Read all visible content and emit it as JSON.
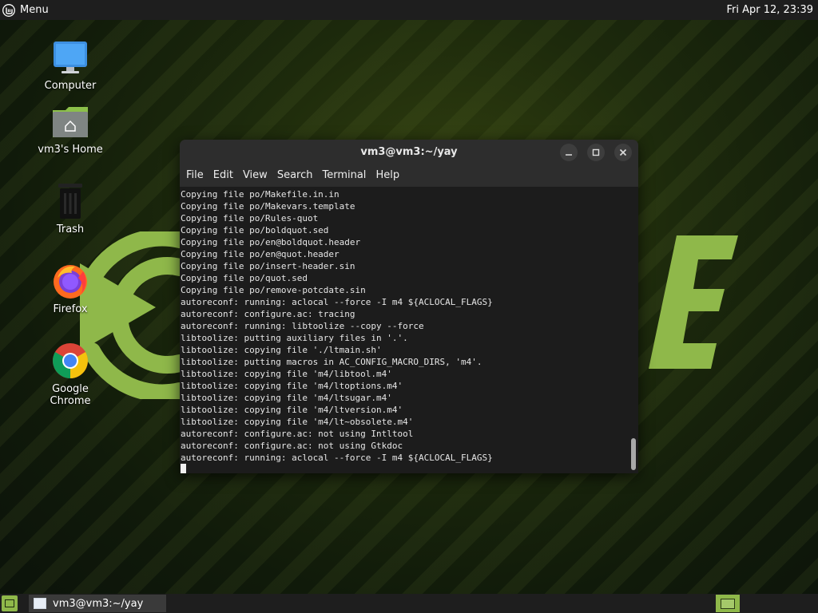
{
  "top_panel": {
    "menu_label": "Menu",
    "clock": "Fri Apr 12, 23:39"
  },
  "desktop_icons": [
    {
      "label": "Computer",
      "icon": "computer-icon"
    },
    {
      "label": "vm3's Home",
      "icon": "home-folder-icon"
    },
    {
      "label": "Trash",
      "icon": "trash-icon"
    },
    {
      "label": "Firefox",
      "icon": "firefox-icon"
    },
    {
      "label": "Google Chrome",
      "icon": "chrome-icon"
    }
  ],
  "terminal": {
    "title": "vm3@vm3:~/yay",
    "menu": [
      "File",
      "Edit",
      "View",
      "Search",
      "Terminal",
      "Help"
    ],
    "lines": [
      "Copying file po/Makefile.in.in",
      "Copying file po/Makevars.template",
      "Copying file po/Rules-quot",
      "Copying file po/boldquot.sed",
      "Copying file po/en@boldquot.header",
      "Copying file po/en@quot.header",
      "Copying file po/insert-header.sin",
      "Copying file po/quot.sed",
      "Copying file po/remove-potcdate.sin",
      "autoreconf: running: aclocal --force -I m4 ${ACLOCAL_FLAGS}",
      "autoreconf: configure.ac: tracing",
      "autoreconf: running: libtoolize --copy --force",
      "libtoolize: putting auxiliary files in '.'.",
      "libtoolize: copying file './ltmain.sh'",
      "libtoolize: putting macros in AC_CONFIG_MACRO_DIRS, 'm4'.",
      "libtoolize: copying file 'm4/libtool.m4'",
      "libtoolize: copying file 'm4/ltoptions.m4'",
      "libtoolize: copying file 'm4/ltsugar.m4'",
      "libtoolize: copying file 'm4/ltversion.m4'",
      "libtoolize: copying file 'm4/lt~obsolete.m4'",
      "autoreconf: configure.ac: not using Intltool",
      "autoreconf: configure.ac: not using Gtkdoc",
      "autoreconf: running: aclocal --force -I m4 ${ACLOCAL_FLAGS}"
    ]
  },
  "taskbar": {
    "items": [
      {
        "label": "vm3@vm3:~/yay",
        "icon": "terminal-window-icon"
      }
    ]
  },
  "colors": {
    "accent": "#8fb84a",
    "panel": "#1e1e1e",
    "terminal_bg": "#1c1c1c"
  }
}
